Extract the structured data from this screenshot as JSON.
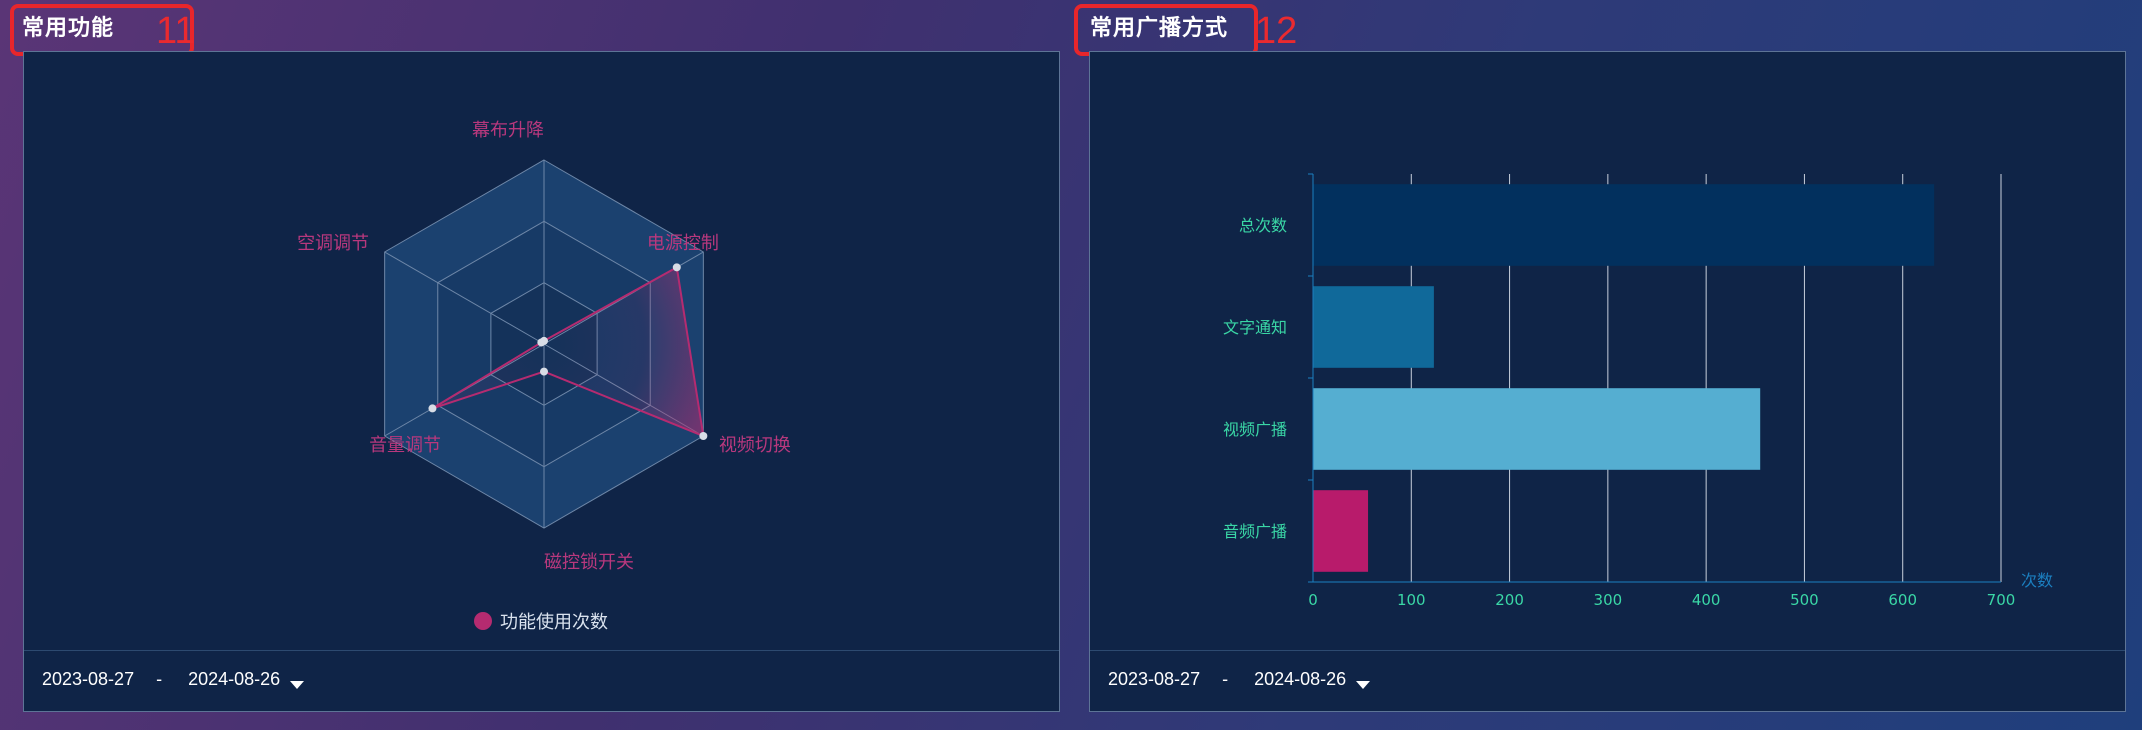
{
  "colors": {
    "accent_pink": "#b52b70",
    "radar_label": "#b8387d",
    "bar_label": "#3ad7a6",
    "axis_unit": "#1b7fc0",
    "marker_red": "#e8262b",
    "bar_total": "#02305e",
    "bar_text": "#10699a",
    "bar_video": "#55aed1",
    "bar_audio": "#b81b6b"
  },
  "left_panel": {
    "title": "常用功能",
    "marker_number": "11",
    "legend_label": "功能使用次数",
    "date_start": "2023-08-27",
    "date_separator": "-",
    "date_end": "2024-08-26"
  },
  "right_panel": {
    "title": "常用广播方式",
    "marker_number": "12",
    "date_start": "2023-08-27",
    "date_separator": "-",
    "date_end": "2024-08-26"
  },
  "chart_data": [
    {
      "type": "radar",
      "indicators": [
        "幕布升降",
        "电源控制",
        "视频切换",
        "磁控锁开关",
        "音量调节",
        "空调调节"
      ],
      "max": 300,
      "series": [
        {
          "name": "功能使用次数",
          "values": [
            5,
            250,
            300,
            45,
            210,
            5
          ]
        }
      ]
    },
    {
      "type": "bar",
      "orientation": "horizontal",
      "categories": [
        "总次数",
        "文字通知",
        "视频广播",
        "音频广播"
      ],
      "values": [
        632,
        123,
        455,
        56
      ],
      "xlim": [
        0,
        700
      ],
      "xticks": [
        "0",
        "100",
        "200",
        "300",
        "400",
        "500",
        "600",
        "700"
      ],
      "xlabel": "次数",
      "grid": true
    }
  ]
}
